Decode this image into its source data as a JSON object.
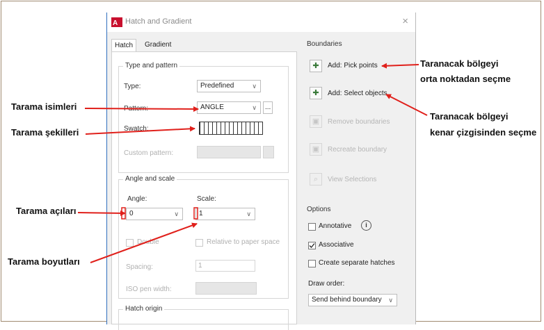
{
  "dialog": {
    "title": "Hatch and Gradient",
    "close_label": "×",
    "tabs": [
      "Hatch",
      "Gradient"
    ],
    "type_and_pattern": {
      "title": "Type and pattern",
      "type_label": "Type:",
      "type_value": "Predefined",
      "pattern_label": "Pattern:",
      "pattern_value": "ANGLE",
      "pattern_browse": "...",
      "swatch_label": "Swatch:",
      "custom_pattern_label": "Custom pattern:"
    },
    "angle_and_scale": {
      "title": "Angle and scale",
      "angle_label": "Angle:",
      "angle_value": "0",
      "scale_label": "Scale:",
      "scale_value": "1",
      "double_label": "Double",
      "relative_label": "Relative to paper space",
      "spacing_label": "Spacing:",
      "spacing_value": "1",
      "iso_label": "ISO pen width:"
    },
    "hatch_origin_title": "Hatch origin",
    "boundaries": {
      "title": "Boundaries",
      "pick_points": "Add: Pick points",
      "select_objects": "Add: Select objects",
      "remove": "Remove boundaries",
      "recreate": "Recreate boundary",
      "view": "View Selections"
    },
    "options": {
      "title": "Options",
      "annotative": "Annotative",
      "associative": "Associative",
      "separate": "Create separate hatches",
      "draw_order_label": "Draw order:",
      "draw_order_value": "Send behind boundary"
    }
  },
  "callouts": {
    "names": "Tarama isimleri",
    "shapes": "Tarama şekilleri",
    "angles": "Tarama açıları",
    "sizes": "Tarama boyutları",
    "pick_1": "Taranacak bölgeyi",
    "pick_2": "orta noktadan seçme",
    "select_1": "Taranacak bölgeyi",
    "select_2": "kenar çizgisinden seçme"
  },
  "colors": {
    "arrow": "#e0201b",
    "accent": "#2f6fbd"
  }
}
